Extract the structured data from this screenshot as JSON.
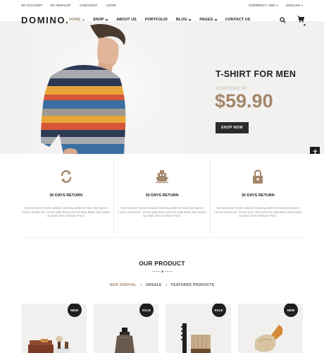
{
  "topbar": {
    "links": [
      "MY ACCOUNT",
      "MY WISHLIST",
      "CHECKOUT",
      "LOGIN"
    ],
    "currency": "CURRENCY: USD",
    "language": "ENGLISH"
  },
  "header": {
    "logo": "DOMINO.",
    "nav": [
      "HOME",
      "SHOP",
      "ABOUT US",
      "PORTFOLIO",
      "BLOG",
      "PAGES",
      "CONTACT US"
    ],
    "cart_count": "0"
  },
  "hero": {
    "title": "T-SHIRT FOR MEN",
    "subtitle": "STARTING AT:",
    "price": "$59.90",
    "button": "SHOP NOW"
  },
  "features": [
    {
      "icon": "refresh-icon",
      "title": "30 DAYS RETURN",
      "text": "Skinny jeans trouser plaited clashing patterns maxi skirt green Lanvin headscarf. Street style dress printed nails Black 90s button up white shirt knitwear Paris."
    },
    {
      "icon": "ship-icon",
      "title": "30 DAYS RETURN",
      "text": "Skinny jeans trouser plaited clashing patterns maxi skirt green Lanvin headscarf. Street style dress printed nails Black 90s button up white shirt knitwear Paris."
    },
    {
      "icon": "lock-icon",
      "title": "30 DAYS RETURN",
      "text": "Skinny jeans trouser plaited clashing patterns maxi skirt green Lanvin headscarf. Street style dress printed nails Black 90s button up white shirt knitwear Paris."
    }
  ],
  "products_section": {
    "title": "OUR PRODUCT",
    "tabs": [
      "NEW ARRIVAL",
      "ONSALE",
      "FEATURED PRODUCTS"
    ],
    "tab_separator": "+",
    "cards": [
      {
        "badge": "NEW",
        "item": "shaving-set"
      },
      {
        "badge": "SALE",
        "item": "shaving-brush"
      },
      {
        "badge": "SALE",
        "item": "hair-brush"
      },
      {
        "badge": "NEW",
        "item": "beard-brush"
      }
    ]
  },
  "colors": {
    "accent": "#a3876b",
    "dark": "#1f1f1f",
    "hero_bg": "#f2f1f0"
  }
}
